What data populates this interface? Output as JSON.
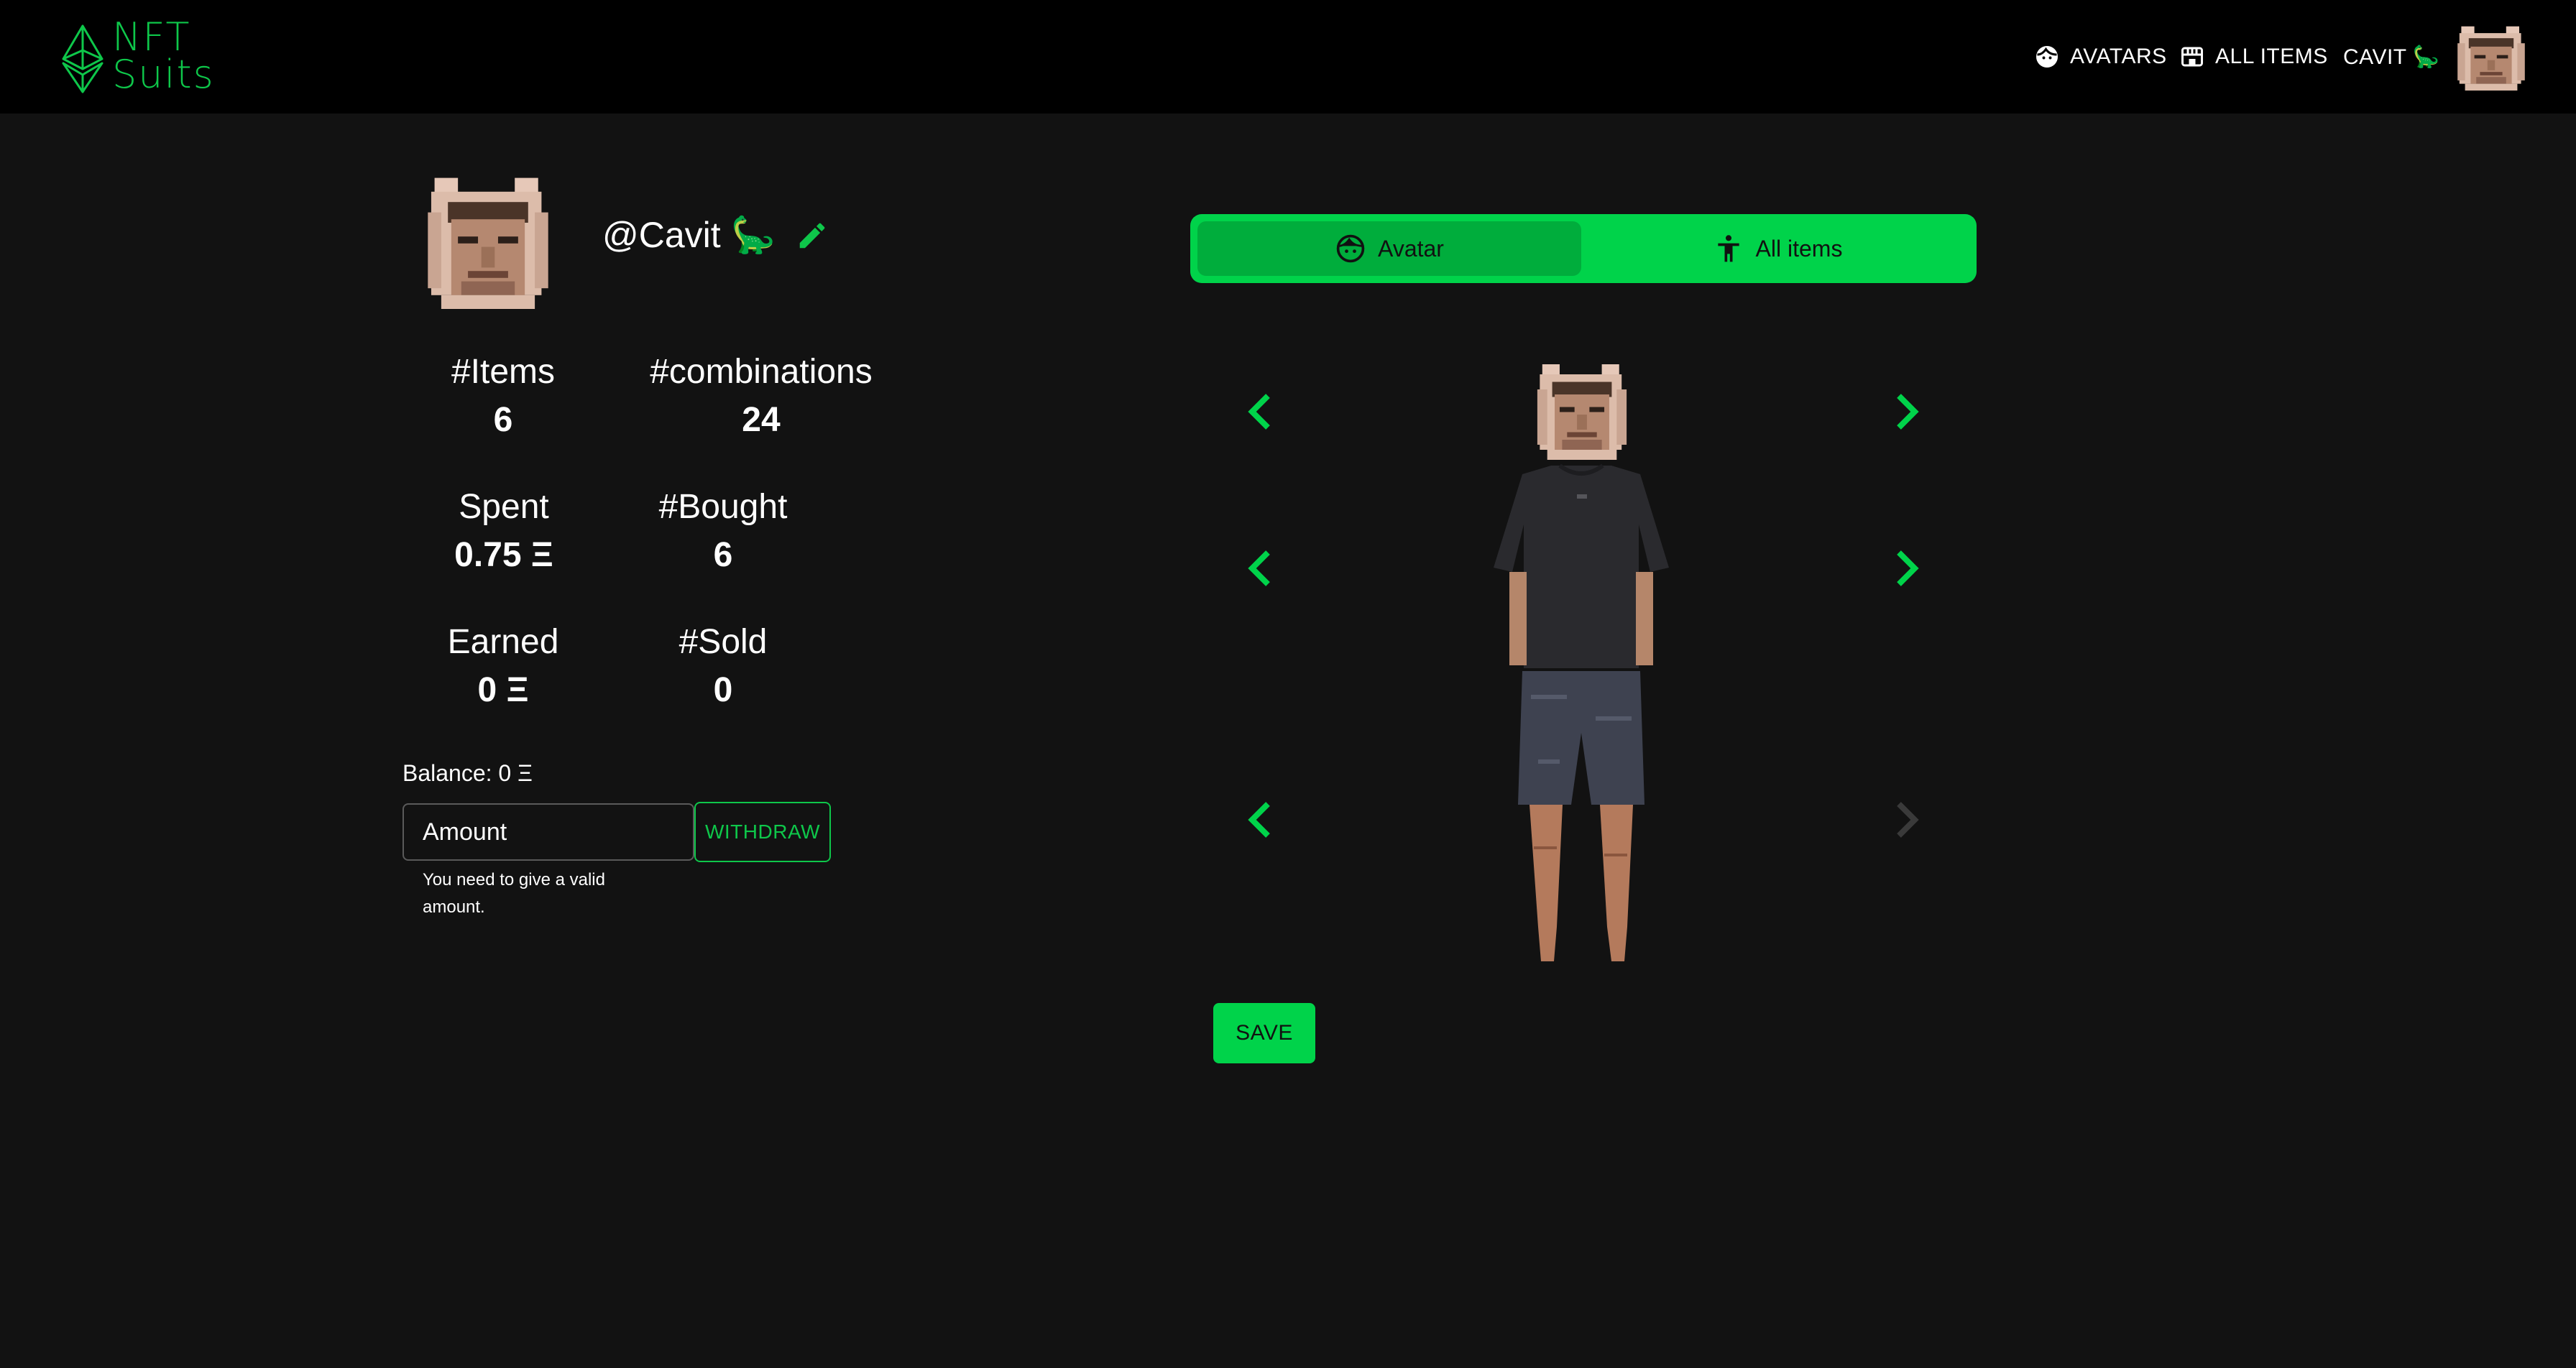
{
  "brand": {
    "line1": "NFT",
    "line2": "Suits",
    "color": "#0ec74a"
  },
  "nav": {
    "avatars_label": "AVATARS",
    "all_items_label": "ALL ITEMS",
    "user_label": "CAVIT 🦕",
    "avatars_icon": "face-icon",
    "all_items_icon": "store-icon"
  },
  "profile": {
    "username": "@Cavit 🦕",
    "stats": {
      "items_label": "#Items",
      "items_value": "6",
      "combinations_label": "#combinations",
      "combinations_value": "24",
      "spent_label": "Spent",
      "spent_value": "0.75 Ξ",
      "bought_label": "#Bought",
      "bought_value": "6",
      "earned_label": "Earned",
      "earned_value": "0 Ξ",
      "sold_label": "#Sold",
      "sold_value": "0"
    },
    "balance": "Balance: 0 Ξ",
    "amount_placeholder": "Amount",
    "withdraw_label": "WITHDRAW",
    "helper_text": "You need to give a valid amount."
  },
  "editor": {
    "tabs": [
      {
        "label": "Avatar",
        "icon": "face-icon",
        "selected": true
      },
      {
        "label": "All items",
        "icon": "accessibility-icon",
        "selected": false
      }
    ],
    "slots": [
      {
        "name": "head",
        "prev_enabled": true,
        "next_enabled": true
      },
      {
        "name": "top",
        "prev_enabled": true,
        "next_enabled": true
      },
      {
        "name": "bottom",
        "prev_enabled": true,
        "next_enabled": false
      }
    ],
    "save_label": "SAVE"
  },
  "colors": {
    "accent": "#00d34a",
    "accent_dark": "#00ad3c",
    "background": "#121212",
    "topbar": "#000000",
    "disabled_arrow": "#3a3a3a"
  }
}
